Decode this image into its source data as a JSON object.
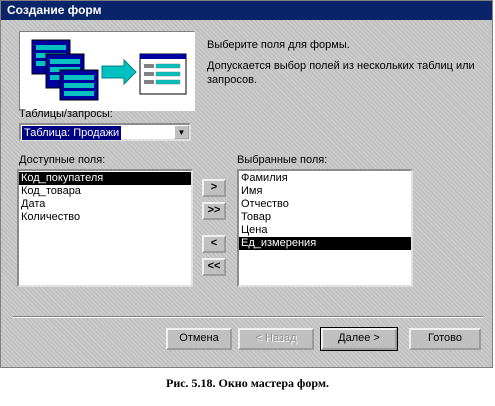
{
  "window": {
    "title": "Создание форм"
  },
  "header": {
    "line1": "Выберите поля для формы.",
    "line2": "Допускается выбор полей из нескольких таблиц или запросов."
  },
  "tables_label": "Таблицы/запросы:",
  "tables_select": {
    "value": "Таблица: Продажи"
  },
  "available": {
    "label": "Доступные поля:",
    "items": [
      "Код_покупателя",
      "Код_товара",
      "Дата",
      "Количество"
    ],
    "selected_index": 0
  },
  "selected": {
    "label": "Выбранные поля:",
    "items": [
      "Фамилия",
      "Имя",
      "Отчество",
      "Товар",
      "Цена",
      "Ед_измерения"
    ],
    "selected_index": 5
  },
  "move_buttons": {
    "add": ">",
    "add_all": ">>",
    "remove": "<",
    "remove_all": "<<"
  },
  "footer_buttons": {
    "cancel": "Отмена",
    "back": "< Назад",
    "next": "Далее >",
    "finish": "Готово"
  },
  "caption": "Рис. 5.18. Окно мастера форм."
}
